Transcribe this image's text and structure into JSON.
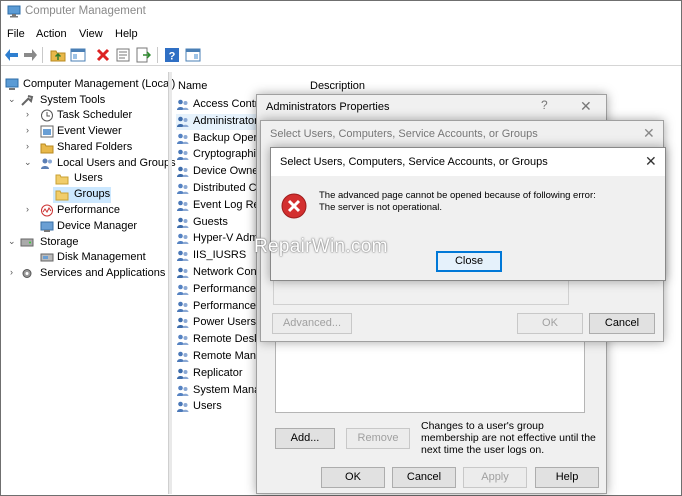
{
  "window": {
    "title": "Computer Management"
  },
  "menu": [
    "File",
    "Action",
    "View",
    "Help"
  ],
  "toolbar": {
    "icons": [
      "back-arrow-icon",
      "forward-arrow-icon",
      "up-folder-icon",
      "show-hide-tree-icon",
      "delete-icon",
      "properties-icon",
      "export-list-icon",
      "help-icon",
      "show-hide-action-pane-icon"
    ]
  },
  "tree": {
    "items": [
      {
        "label": "Computer Management (Local)",
        "icon": "computer-management-icon"
      },
      {
        "label": "System Tools",
        "icon": "tools-icon"
      },
      {
        "label": "Task Scheduler",
        "icon": "clock-icon"
      },
      {
        "label": "Event Viewer",
        "icon": "event-viewer-icon"
      },
      {
        "label": "Shared Folders",
        "icon": "shared-folder-icon"
      },
      {
        "label": "Local Users and Groups",
        "icon": "users-icon"
      },
      {
        "label": "Users",
        "icon": "folder-icon"
      },
      {
        "label": "Groups",
        "icon": "folder-icon"
      },
      {
        "label": "Performance",
        "icon": "performance-icon"
      },
      {
        "label": "Device Manager",
        "icon": "device-manager-icon"
      },
      {
        "label": "Storage",
        "icon": "storage-icon"
      },
      {
        "label": "Disk Management",
        "icon": "disk-icon"
      },
      {
        "label": "Services and Applications",
        "icon": "services-icon"
      }
    ]
  },
  "list": {
    "columns": [
      "Name",
      "Description"
    ],
    "rows": [
      "Access Control",
      "Administrators",
      "Backup Operators",
      "Cryptographic",
      "Device Owners",
      "Distributed COM",
      "Event Log Readers",
      "Guests",
      "Hyper-V Adm",
      "IIS_IUSRS",
      "Network Conf",
      "Performance L",
      "Performance M",
      "Power Users",
      "Remote Deskt",
      "Remote Mana",
      "Replicator",
      "System Mana",
      "Users"
    ]
  },
  "admin_dialog": {
    "title": "Administrators Properties",
    "help": "?",
    "close": "✕",
    "membership_note": "Changes to a user's group membership are not effective until the next time the user logs on.",
    "buttons": {
      "add": "Add...",
      "remove": "Remove",
      "ok": "OK",
      "cancel": "Cancel",
      "apply": "Apply",
      "help": "Help"
    }
  },
  "select_dialog_back": {
    "title": "Select Users, Computers, Service Accounts, or Groups",
    "close": "✕",
    "buttons": {
      "advanced": "Advanced...",
      "ok": "OK",
      "cancel": "Cancel"
    }
  },
  "error_dialog": {
    "title": "Select Users, Computers, Service Accounts, or Groups",
    "close": "✕",
    "message_line1": "The advanced page cannot be opened because of following error:",
    "message_line2": "The server is not operational.",
    "close_button": "Close"
  },
  "watermark": "RepairWin.com",
  "colors": {
    "error_red": "#d32f2f",
    "accent": "#0078d7",
    "selection": "#cce8ff"
  }
}
